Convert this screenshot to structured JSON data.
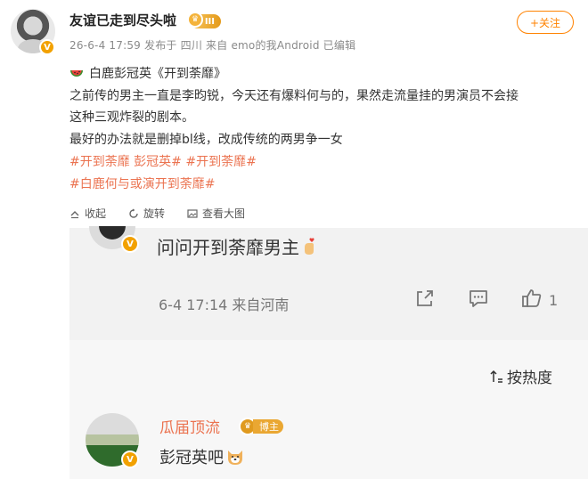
{
  "post": {
    "author": "友谊已走到尽头啦",
    "rank_badge": "III",
    "meta": "26-6-4 17:59 发布于 四川 来自 emo的我Android 已编辑",
    "follow_label": "+关注",
    "title_line": "白鹿彭冠英《开到荼靡》",
    "body_line1": "之前传的男主一直是李昀锐，今天还有爆料何与的，果然走流量挂的男演员不会接",
    "body_line2": "这种三观炸裂的剧本。",
    "body_line3": "最好的办法就是删掉bl线，改成传统的两男争一女",
    "tags_line1": "#开到荼靡 彭冠英# #开到荼靡#",
    "tags_line2": "#白鹿何与或演开到荼靡#",
    "actions": {
      "collect": "收起",
      "repost": "旋转",
      "view_large": "查看大图"
    }
  },
  "reply": {
    "text": "问问开到荼靡男主",
    "meta": "6-4 17:14 来自河南",
    "like_count": "1"
  },
  "comments": {
    "sort_label": "按热度",
    "items": [
      {
        "name": "瓜届顶流",
        "badge": "博主",
        "text": "彭冠英吧"
      }
    ]
  },
  "colors": {
    "accent": "#ff8200",
    "tag": "#eb7350",
    "badge_gold": "#eaa732",
    "verified": "#f2a100"
  },
  "icons": [
    "watermelon-icon",
    "collapse-icon",
    "repost-icon",
    "image-icon",
    "share-icon",
    "comment-icon",
    "like-icon",
    "sort-icon",
    "dog-emoji-icon",
    "hand-heart-icon",
    "crown-icon"
  ]
}
